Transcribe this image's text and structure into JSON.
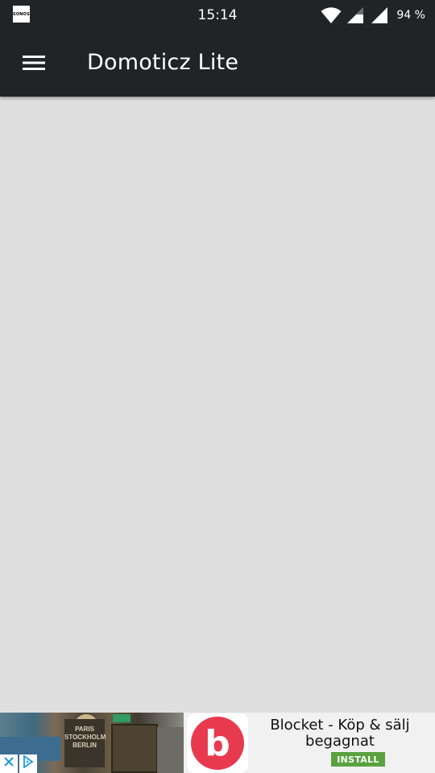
{
  "status_bar": {
    "app_icon_label": "SONOS",
    "time": "15:14",
    "battery": "94 %",
    "icons": [
      "wifi-icon",
      "signal-icon",
      "signal-icon"
    ]
  },
  "app_bar": {
    "menu_icon": "hamburger-menu-icon",
    "title": "Domoticz Lite"
  },
  "colors": {
    "app_bar": "#212327",
    "content_background": "#dfdfdf",
    "ad_background": "#f1f1f1",
    "ad_brand": "#e83a4e",
    "install_button": "#5aa13f"
  },
  "ad": {
    "photo_text": "PARIS STOCKHOLM BERLIN",
    "close_icon": "close-icon",
    "adchoices_icon": "adchoices-icon",
    "app_icon_letter": "b",
    "app_name": "Blocket - Köp & sälj begagnat",
    "install_label": "INSTALL"
  }
}
